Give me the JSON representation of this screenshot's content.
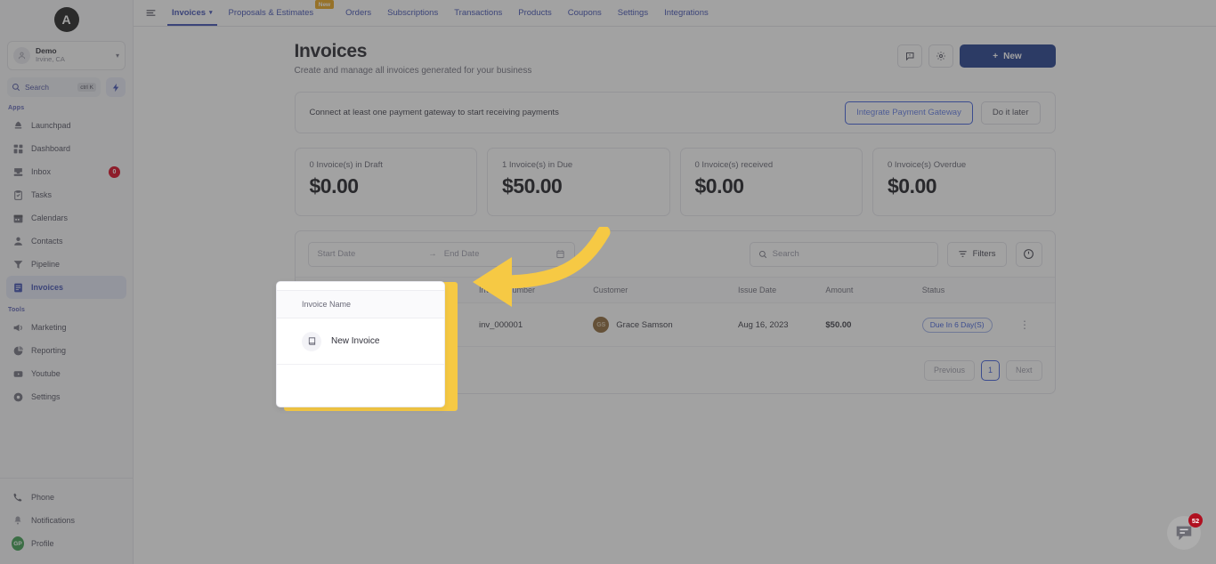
{
  "sidebar": {
    "logo_text": "A",
    "account": {
      "name": "Demo",
      "location": "Irvine, CA"
    },
    "search": {
      "label": "Search",
      "shortcut": "ctrl K"
    },
    "group_apps_label": "Apps",
    "group_tools_label": "Tools",
    "apps": [
      {
        "label": "Launchpad",
        "icon": "rocket-icon"
      },
      {
        "label": "Dashboard",
        "icon": "grid-icon"
      },
      {
        "label": "Inbox",
        "icon": "inbox-icon",
        "badge": "0"
      },
      {
        "label": "Tasks",
        "icon": "clipboard-icon"
      },
      {
        "label": "Calendars",
        "icon": "calendar-icon"
      },
      {
        "label": "Contacts",
        "icon": "person-icon"
      },
      {
        "label": "Pipeline",
        "icon": "funnel-icon"
      },
      {
        "label": "Invoices",
        "icon": "invoice-icon",
        "active": true
      }
    ],
    "tools": [
      {
        "label": "Marketing",
        "icon": "megaphone-icon"
      },
      {
        "label": "Reporting",
        "icon": "pie-chart-icon"
      },
      {
        "label": "Youtube",
        "icon": "video-icon"
      },
      {
        "label": "Settings",
        "icon": "gear-icon"
      }
    ],
    "bottom": [
      {
        "label": "Phone",
        "icon": "phone-icon"
      },
      {
        "label": "Notifications",
        "icon": "bell-icon"
      },
      {
        "label": "Profile",
        "icon": "avatar",
        "initials": "GP"
      }
    ]
  },
  "topnav": {
    "tabs": [
      {
        "label": "Invoices",
        "selected": true,
        "has_chevron": true
      },
      {
        "label": "Proposals & Estimates",
        "badge": "New"
      },
      {
        "label": "Orders"
      },
      {
        "label": "Subscriptions"
      },
      {
        "label": "Transactions"
      },
      {
        "label": "Products"
      },
      {
        "label": "Coupons"
      },
      {
        "label": "Settings"
      },
      {
        "label": "Integrations"
      }
    ]
  },
  "header": {
    "title": "Invoices",
    "subtitle": "Create and manage all invoices generated for your business",
    "new_button": "New",
    "new_button_plus": "+"
  },
  "banner": {
    "text": "Connect at least one payment gateway to start receiving payments",
    "primary_label": "Integrate Payment Gateway",
    "secondary_label": "Do it later"
  },
  "stats": [
    {
      "label": "0 Invoice(s) in Draft",
      "value": "$0.00"
    },
    {
      "label": "1 Invoice(s) in Due",
      "value": "$50.00"
    },
    {
      "label": "0 Invoice(s) received",
      "value": "$0.00"
    },
    {
      "label": "0 Invoice(s) Overdue",
      "value": "$0.00"
    }
  ],
  "toolbar": {
    "start_date_placeholder": "Start Date",
    "range_arrow": "→",
    "end_date_placeholder": "End Date",
    "search_placeholder": "Search",
    "filters_label": "Filters"
  },
  "table": {
    "columns": [
      "Invoice Name",
      "Invoice Number",
      "Customer",
      "Issue Date",
      "Amount",
      "Status",
      ""
    ],
    "rows": [
      {
        "invoice_name": "New Invoice",
        "invoice_number": "inv_000001",
        "customer": "Grace Samson",
        "customer_initials": "GS",
        "issue_date": "Aug 16, 2023",
        "amount": "$50.00",
        "status": "Due In 6 Day(S)",
        "menu": "⋮"
      }
    ]
  },
  "pagination": {
    "previous": "Previous",
    "page": "1",
    "next": "Next"
  },
  "popup": {
    "header": "Invoice Name",
    "item_label": "New Invoice"
  },
  "chat": {
    "badge": "52"
  },
  "colors": {
    "accent_blue": "#3b5bdb",
    "primary_button": "#1e3a8a",
    "highlight_yellow": "#f6c944",
    "badge_red": "#d9001b",
    "new_badge_orange": "#e8a317",
    "chat_badge_red": "#b01020",
    "avatar_green": "#3a9b4e",
    "customer_avatar_brown": "#8b6535"
  }
}
